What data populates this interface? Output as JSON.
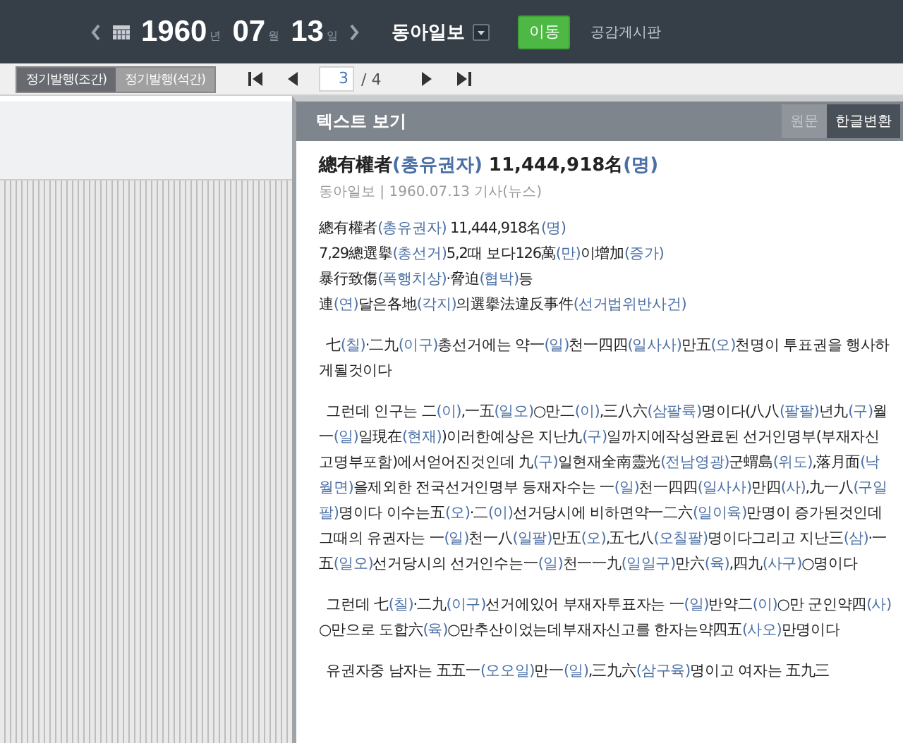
{
  "top_bar": {
    "year": "1960",
    "year_unit": "년",
    "month": "07",
    "month_unit": "월",
    "day": "13",
    "day_unit": "일",
    "newspaper": "동아일보",
    "go_button": "이동",
    "board_link": "공감게시판"
  },
  "edition_tabs": [
    {
      "label": "정기발행(조간)",
      "selected": true
    },
    {
      "label": "정기발행(석간)",
      "selected": false
    }
  ],
  "pager": {
    "page": "3",
    "total": "/ 4"
  },
  "text_panel": {
    "title": "텍스트 보기",
    "modes": [
      {
        "label": "원문",
        "selected": false
      },
      {
        "label": "한글변환",
        "selected": true
      }
    ],
    "headline": [
      {
        "text": "總有權者",
        "reading": false
      },
      {
        "text": "(총유권자)",
        "reading": true
      },
      {
        "text": " 11,444,918名",
        "reading": false
      },
      {
        "text": "(명)",
        "reading": true
      }
    ],
    "byline": "동아일보 | 1960.07.13 기사(뉴스)",
    "lead_lines": [
      [
        {
          "text": "總有權者",
          "reading": false
        },
        {
          "text": "(총유권자)",
          "reading": true
        },
        {
          "text": " 11,444,918名",
          "reading": false
        },
        {
          "text": "(명)",
          "reading": true
        }
      ],
      [
        {
          "text": "7,29總選擧",
          "reading": false
        },
        {
          "text": "(총선거)",
          "reading": true
        },
        {
          "text": "5,2때 보다126萬",
          "reading": false
        },
        {
          "text": "(만)",
          "reading": true
        },
        {
          "text": "이增加",
          "reading": false
        },
        {
          "text": "(증가)",
          "reading": true
        }
      ],
      [
        {
          "text": "暴行致傷",
          "reading": false
        },
        {
          "text": "(폭행치상)",
          "reading": true
        },
        {
          "text": "·脅迫",
          "reading": false
        },
        {
          "text": "(협박)",
          "reading": true
        },
        {
          "text": "등",
          "reading": false
        }
      ],
      [
        {
          "text": "連",
          "reading": false
        },
        {
          "text": "(연)",
          "reading": true
        },
        {
          "text": "달은各地",
          "reading": false
        },
        {
          "text": "(각지)",
          "reading": true
        },
        {
          "text": "의選擧法違反事件",
          "reading": false
        },
        {
          "text": "(선거법위반사건)",
          "reading": true
        }
      ]
    ],
    "paragraphs": [
      [
        {
          "text": "七",
          "reading": false
        },
        {
          "text": "(칠)",
          "reading": true
        },
        {
          "text": "·二九",
          "reading": false
        },
        {
          "text": "(이구)",
          "reading": true
        },
        {
          "text": "총선거에는 약一",
          "reading": false
        },
        {
          "text": "(일)",
          "reading": true
        },
        {
          "text": "천一四四",
          "reading": false
        },
        {
          "text": "(일사사)",
          "reading": true
        },
        {
          "text": "만五",
          "reading": false
        },
        {
          "text": "(오)",
          "reading": true
        },
        {
          "text": "천명이 투표권을 행사하게될것이다",
          "reading": false
        }
      ],
      [
        {
          "text": "그런데 인구는 二",
          "reading": false
        },
        {
          "text": "(이)",
          "reading": true
        },
        {
          "text": ",一五",
          "reading": false
        },
        {
          "text": "(일오)",
          "reading": true
        },
        {
          "text": "○만二",
          "reading": false
        },
        {
          "text": "(이)",
          "reading": true
        },
        {
          "text": ",三八六",
          "reading": false
        },
        {
          "text": "(삼팔륙)",
          "reading": true
        },
        {
          "text": "명이다(八八",
          "reading": false
        },
        {
          "text": "(팔팔)",
          "reading": true
        },
        {
          "text": "년九",
          "reading": false
        },
        {
          "text": "(구)",
          "reading": true
        },
        {
          "text": "월一",
          "reading": false
        },
        {
          "text": "(일)",
          "reading": true
        },
        {
          "text": "일現在",
          "reading": false
        },
        {
          "text": "(현재)",
          "reading": true
        },
        {
          "text": ")이러한예상은 지난九",
          "reading": false
        },
        {
          "text": "(구)",
          "reading": true
        },
        {
          "text": "일까지에작성완료된 선거인명부(부재자신고명부포함)에서얻어진것인데 九",
          "reading": false
        },
        {
          "text": "(구)",
          "reading": true
        },
        {
          "text": "일현재全南靈光",
          "reading": false
        },
        {
          "text": "(전남영광)",
          "reading": true
        },
        {
          "text": "군蝟島",
          "reading": false
        },
        {
          "text": "(위도)",
          "reading": true
        },
        {
          "text": ",落月面",
          "reading": false
        },
        {
          "text": "(낙월면)",
          "reading": true
        },
        {
          "text": "을제외한 전국선거인명부 등재자수는 一",
          "reading": false
        },
        {
          "text": "(일)",
          "reading": true
        },
        {
          "text": "천一四四",
          "reading": false
        },
        {
          "text": "(일사사)",
          "reading": true
        },
        {
          "text": "만四",
          "reading": false
        },
        {
          "text": "(사)",
          "reading": true
        },
        {
          "text": ",九一八",
          "reading": false
        },
        {
          "text": "(구일팔)",
          "reading": true
        },
        {
          "text": "명이다 이수는五",
          "reading": false
        },
        {
          "text": "(오)",
          "reading": true
        },
        {
          "text": "·二",
          "reading": false
        },
        {
          "text": "(이)",
          "reading": true
        },
        {
          "text": "선거당시에 비하면약一二六",
          "reading": false
        },
        {
          "text": "(일이육)",
          "reading": true
        },
        {
          "text": "만명이 증가된것인데 그때의 유권자는 一",
          "reading": false
        },
        {
          "text": "(일)",
          "reading": true
        },
        {
          "text": "천一八",
          "reading": false
        },
        {
          "text": "(일팔)",
          "reading": true
        },
        {
          "text": "만五",
          "reading": false
        },
        {
          "text": "(오)",
          "reading": true
        },
        {
          "text": ",五七八",
          "reading": false
        },
        {
          "text": "(오칠팔)",
          "reading": true
        },
        {
          "text": "명이다그리고 지난三",
          "reading": false
        },
        {
          "text": "(삼)",
          "reading": true
        },
        {
          "text": "·一五",
          "reading": false
        },
        {
          "text": "(일오)",
          "reading": true
        },
        {
          "text": "선거당시의 선거인수는一",
          "reading": false
        },
        {
          "text": "(일)",
          "reading": true
        },
        {
          "text": "천一一九",
          "reading": false
        },
        {
          "text": "(일일구)",
          "reading": true
        },
        {
          "text": "만六",
          "reading": false
        },
        {
          "text": "(육)",
          "reading": true
        },
        {
          "text": ",四九",
          "reading": false
        },
        {
          "text": "(사구)",
          "reading": true
        },
        {
          "text": "○명이다",
          "reading": false
        }
      ],
      [
        {
          "text": "그런데 七",
          "reading": false
        },
        {
          "text": "(칠)",
          "reading": true
        },
        {
          "text": "·二九",
          "reading": false
        },
        {
          "text": "(이구)",
          "reading": true
        },
        {
          "text": "선거에있어 부재자투표자는 一",
          "reading": false
        },
        {
          "text": "(일)",
          "reading": true
        },
        {
          "text": "반약二",
          "reading": false
        },
        {
          "text": "(이)",
          "reading": true
        },
        {
          "text": "○만 군인약四",
          "reading": false
        },
        {
          "text": "(사)",
          "reading": true
        },
        {
          "text": "○만으로 도합六",
          "reading": false
        },
        {
          "text": "(육)",
          "reading": true
        },
        {
          "text": "○만추산이었는데부재자신고를 한자는약四五",
          "reading": false
        },
        {
          "text": "(사오)",
          "reading": true
        },
        {
          "text": "만명이다",
          "reading": false
        }
      ],
      [
        {
          "text": "유권자중 남자는 五五一",
          "reading": false
        },
        {
          "text": "(오오일)",
          "reading": true
        },
        {
          "text": "만一",
          "reading": false
        },
        {
          "text": "(일)",
          "reading": true
        },
        {
          "text": ",三九六",
          "reading": false
        },
        {
          "text": "(삼구육)",
          "reading": true
        },
        {
          "text": "명이고 여자는 五九三",
          "reading": false
        }
      ]
    ]
  }
}
